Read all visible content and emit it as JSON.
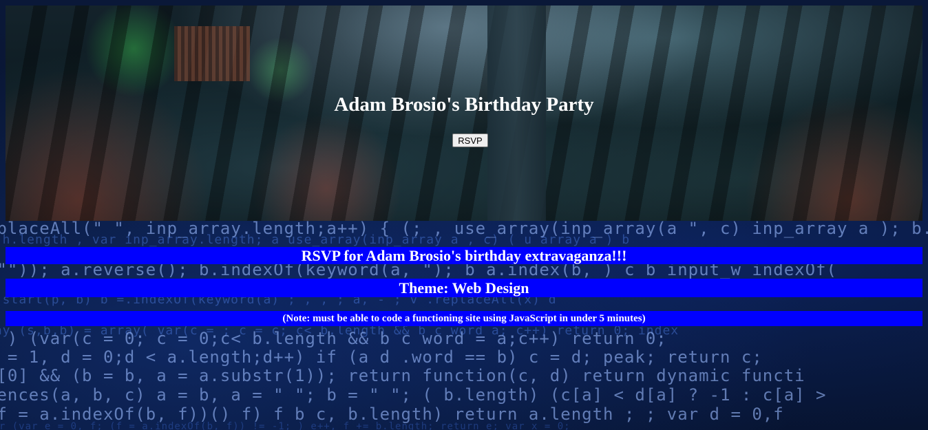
{
  "hero": {
    "title": "Adam Brosio's Birthday Party",
    "rsvp_label": "RSVP"
  },
  "sections": {
    "heading": "RSVP for Adam Brosio's birthday extravaganza!!!",
    "theme": "Theme: Web Design",
    "note": "(Note: must be able to code a functioning site using JavaScript in under 5 minutes)"
  },
  "colors": {
    "banner": "#0000ff",
    "banner_text": "#ffffff",
    "background_code": "#06122a"
  }
}
